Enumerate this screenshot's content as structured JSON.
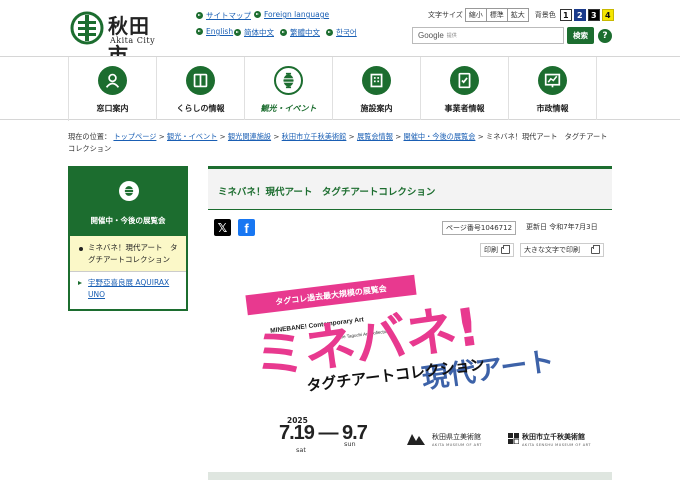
{
  "header": {
    "logo_ja": "秋田市",
    "logo_en": "Akita City",
    "links": {
      "sitemap": "サイトマップ",
      "foreign": "Foreign language",
      "english": "English",
      "zh_s": "简体中文",
      "zh_t": "繁體中文",
      "korean": "한국어"
    },
    "font_size_label": "文字サイズ",
    "font_size_options": [
      "縮小",
      "標準",
      "拡大"
    ],
    "bg_label": "背景色",
    "bg_options": [
      "1",
      "2",
      "3",
      "4"
    ],
    "search_google": "Google",
    "search_provided": "提供",
    "search_button": "検索",
    "help": "?"
  },
  "nav": [
    {
      "label": "窓口案内",
      "icon": "person-icon"
    },
    {
      "label": "くらしの情報",
      "icon": "book-icon"
    },
    {
      "label": "観光・イベント",
      "icon": "lantern-icon"
    },
    {
      "label": "施設案内",
      "icon": "building-icon"
    },
    {
      "label": "事業者情報",
      "icon": "document-icon"
    },
    {
      "label": "市政情報",
      "icon": "chart-icon"
    }
  ],
  "breadcrumb": {
    "prefix": "現在の位置：",
    "items": [
      "トップページ",
      "観光・イベント",
      "観光関連施設",
      "秋田市立千秋美術館",
      "展覧会情報",
      "開催中・今後の展覧会"
    ],
    "current": "ミネバネ！現代アート　タグチアートコレクション",
    "sep": " > "
  },
  "sidebar": {
    "title": "開催中・今後の展覧会",
    "items": [
      "ミネバネ！現代アート　タグチアートコレクション",
      "宇野亞喜良展 AQUIRAX UNO"
    ]
  },
  "main": {
    "title": "ミネバネ！現代アート　タグチアートコレクション",
    "page_no": "ページ番号1046712",
    "updated": "更新日 令和7年7月3日",
    "print": "印刷",
    "print_large": "大きな文字で印刷"
  },
  "poster": {
    "banner": "タグコレ過去最大規模の展覧会",
    "en_title": "MINEBANE! Contemporary Art",
    "en_sub": "– The Taguchi Art Collection",
    "big_title": "ミネバネ!",
    "gendai": "現代アート",
    "sub_ja": "タグチアートコレクション",
    "year": "2025",
    "dates": "7.19 — 9.7",
    "sat": "sat",
    "sun": "sun",
    "museum1": "秋田県立美術館",
    "museum1_en": "AKITA MUSEUM OF ART",
    "museum2": "秋田市立千秋美術館",
    "museum2_en": "AKITA SENSHU MUSEUM OF ART"
  },
  "colors": {
    "brand_green": "#1c6d2f",
    "link_blue": "#1a5fb4",
    "poster_pink": "#e8398f",
    "poster_blue": "#3d62a8"
  }
}
